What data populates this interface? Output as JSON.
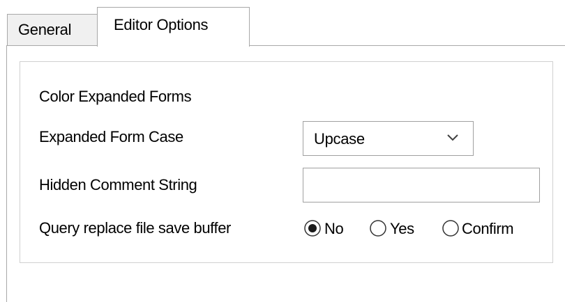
{
  "tabs": {
    "general": "General",
    "editor_options": "Editor Options"
  },
  "options": {
    "color_expanded_forms": "Color Expanded Forms",
    "expanded_form_case_label": "Expanded Form Case",
    "expanded_form_case_value": "Upcase",
    "hidden_comment_string_label": "Hidden Comment String",
    "hidden_comment_string_value": "",
    "query_replace_label": "Query replace file save buffer",
    "radio_no": "No",
    "radio_yes": "Yes",
    "radio_confirm": "Confirm",
    "selected_radio": "No"
  },
  "colors": {
    "border": "#a8a8a8",
    "inactive_tab": "#f0f0f0"
  }
}
